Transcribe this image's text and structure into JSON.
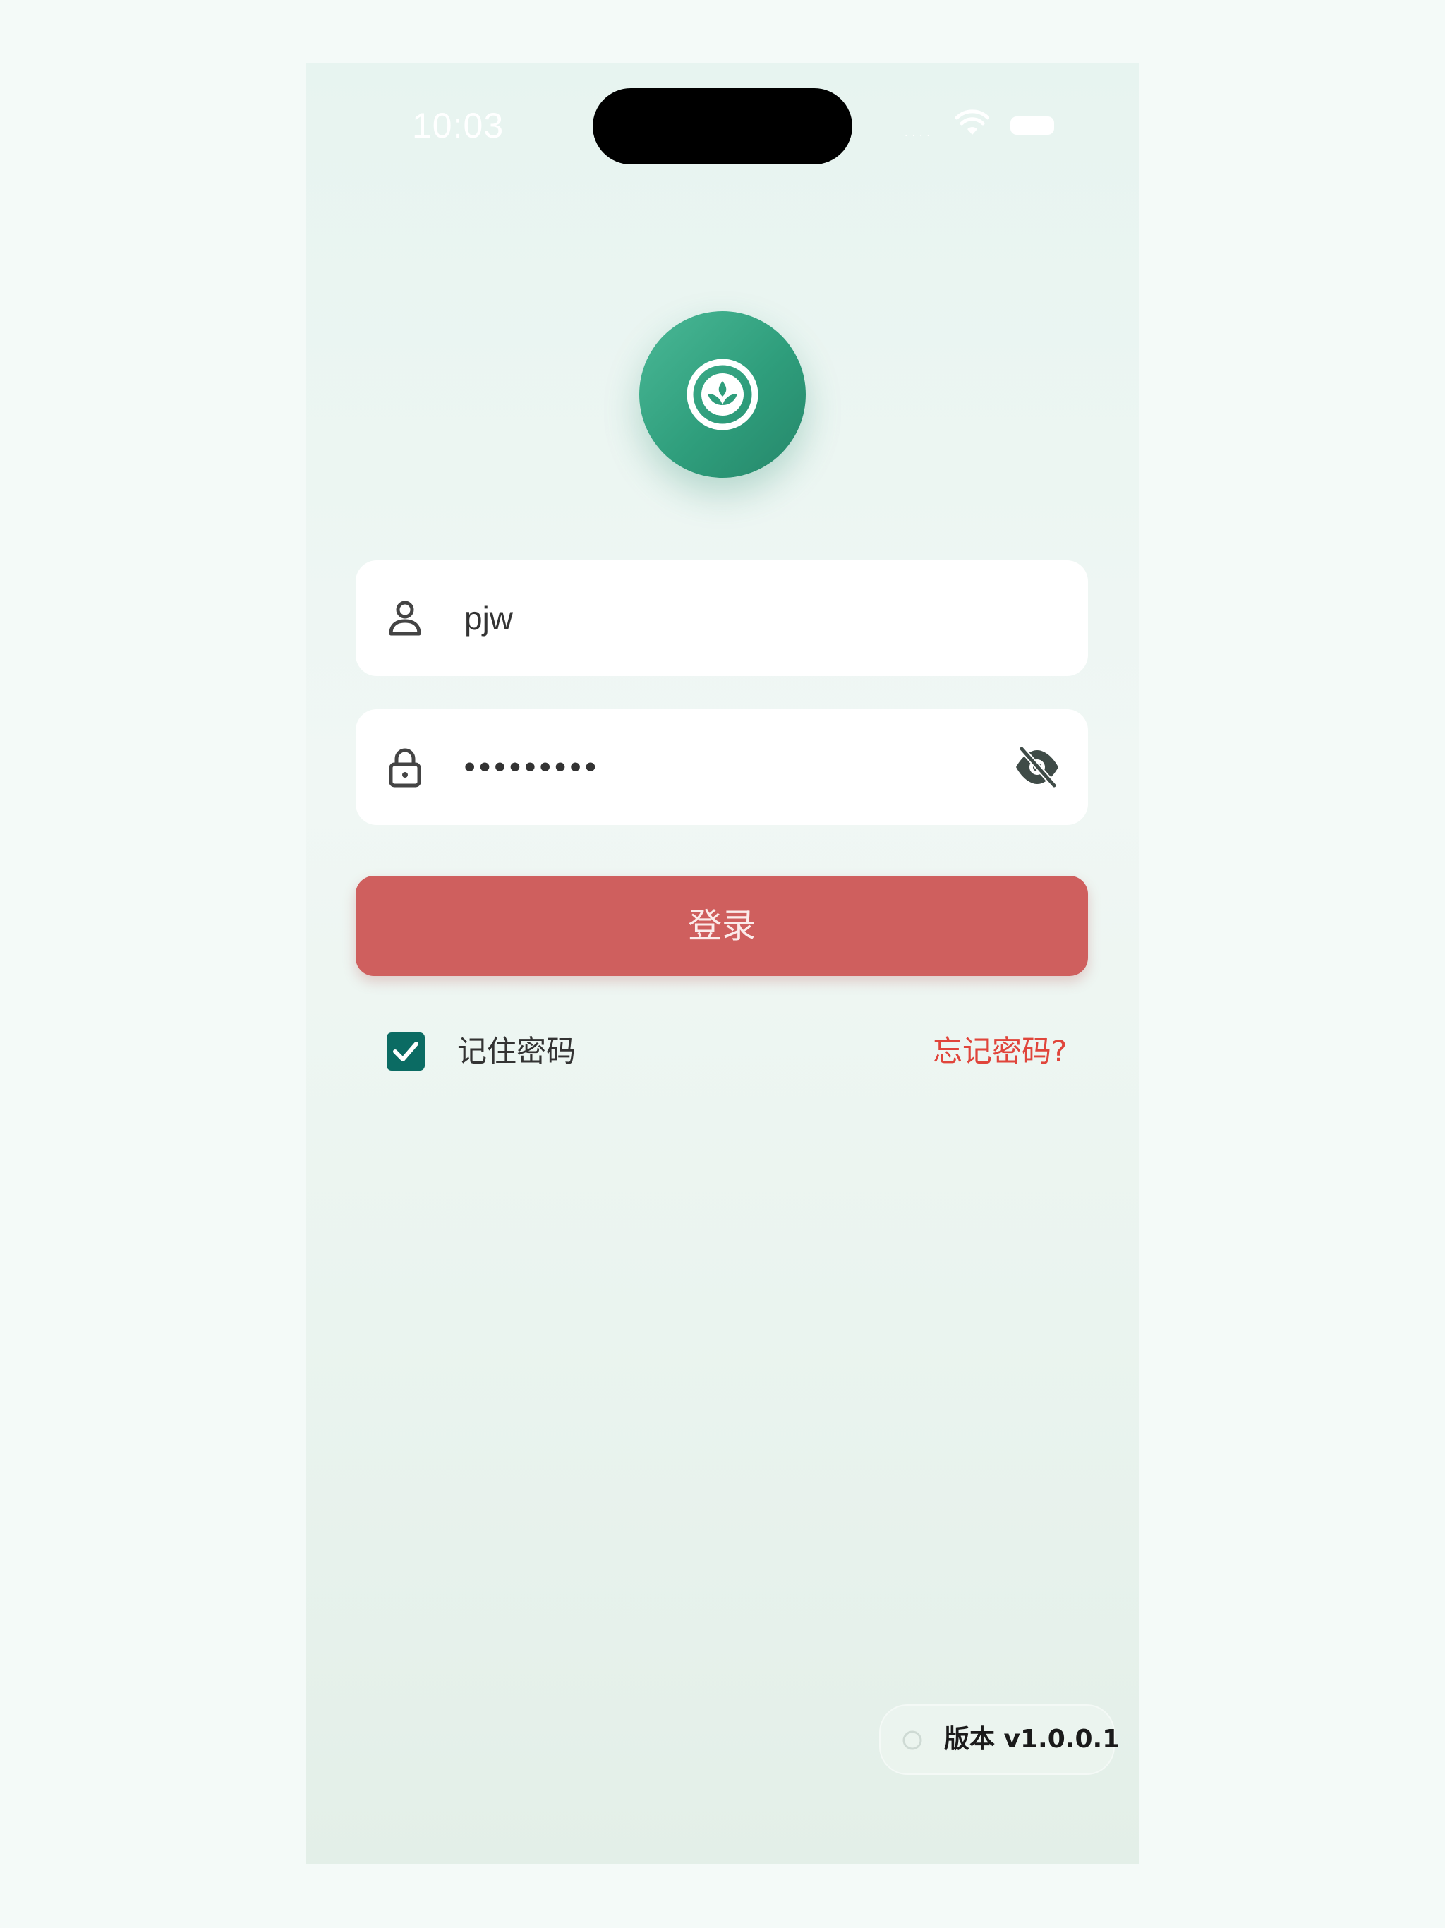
{
  "status_bar": {
    "time": "10:03"
  },
  "app": {
    "logo_icon": "leaf-circle-icon",
    "brand_color": "#2f9e7c"
  },
  "login_form": {
    "username": {
      "value": "pjw",
      "icon": "user-icon"
    },
    "password": {
      "masked_value": "•••••••••",
      "icon": "lock-icon",
      "toggle_icon": "eye-slash-icon"
    },
    "login_label": "登录",
    "login_color": "#cf5f5e",
    "remember_label": "记住密码",
    "remember_checked": true,
    "forgot_label": "忘记密码?",
    "forgot_color": "#e0453b"
  },
  "footer": {
    "version_label": "版本 v1.0.0.1"
  }
}
